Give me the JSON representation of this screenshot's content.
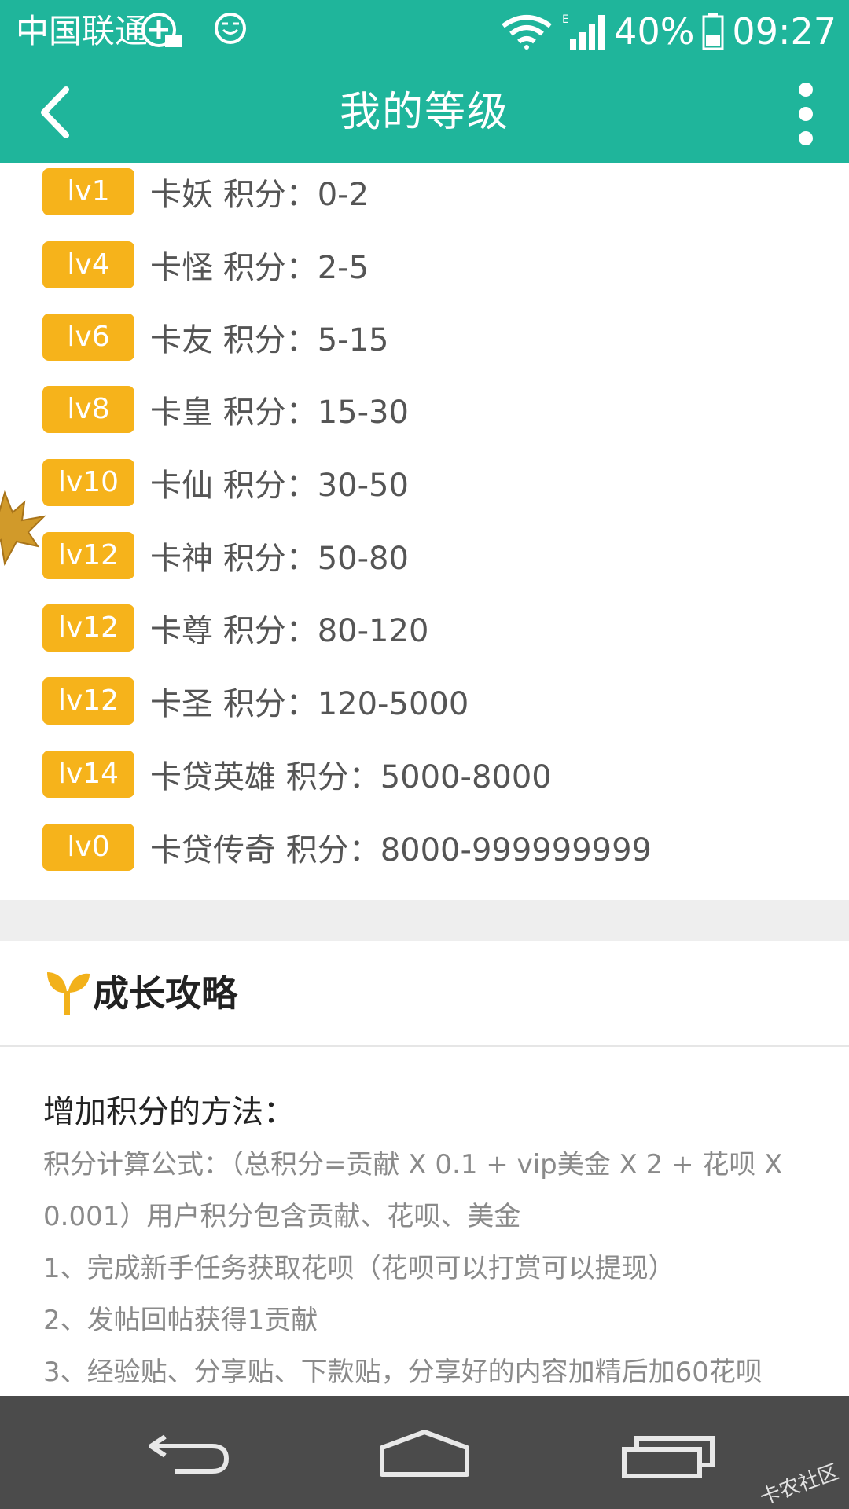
{
  "status_bar": {
    "carrier": "中国联通",
    "battery": "40%",
    "time": "09:27",
    "net_type": "E"
  },
  "app_bar": {
    "title": "我的等级"
  },
  "levels": [
    {
      "badge": "lv1",
      "text": "卡妖  积分：0-2"
    },
    {
      "badge": "lv4",
      "text": "卡怪  积分：2-5"
    },
    {
      "badge": "lv6",
      "text": "卡友  积分：5-15"
    },
    {
      "badge": "lv8",
      "text": "卡皇  积分：15-30"
    },
    {
      "badge": "lv10",
      "text": "卡仙  积分：30-50"
    },
    {
      "badge": "lv12",
      "text": "卡神  积分：50-80"
    },
    {
      "badge": "lv12",
      "text": "卡尊  积分：80-120"
    },
    {
      "badge": "lv12",
      "text": "卡圣  积分：120-5000"
    },
    {
      "badge": "lv14",
      "text": "卡贷英雄  积分：5000-8000"
    },
    {
      "badge": "lv0",
      "text": "卡贷传奇  积分：8000-999999999"
    }
  ],
  "growth": {
    "title": "成长攻略",
    "methods_title": "增加积分的方法：",
    "lines": [
      "积分计算公式：（总积分=贡献 X 0.1 + vip美金 X 2 + 花呗 X",
      "0.001）用户积分包含贡献、花呗、美金",
      "1、完成新手任务获取花呗（花呗可以打赏可以提现）",
      "2、发帖回帖获得1贡献",
      "3、经验贴、分享贴、下款贴，分享好的内容加精后加60花呗"
    ]
  },
  "watermark": "卡农社区",
  "colors": {
    "header": "#1fb59b",
    "badge": "#f6b31b",
    "navbar": "#4b4b4b"
  }
}
